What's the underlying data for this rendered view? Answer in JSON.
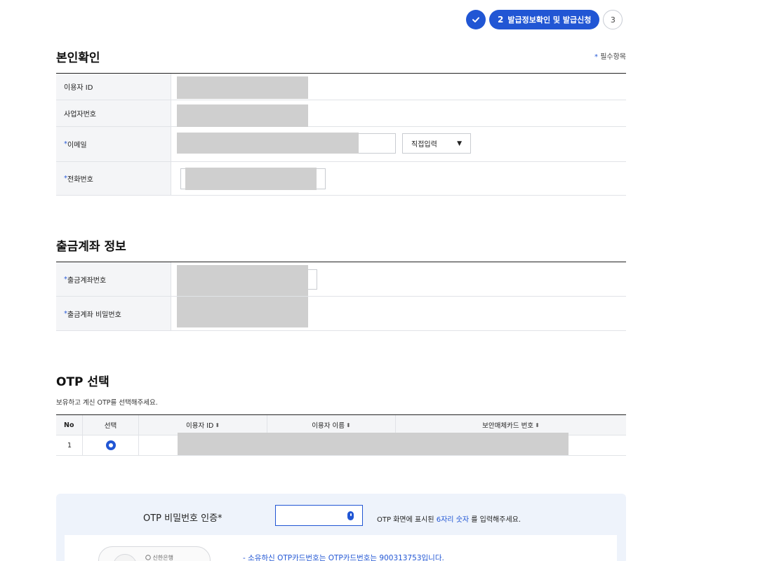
{
  "steps": {
    "active_number": "2",
    "active_label": "발급정보확인 및 발급신청",
    "next_number": "3"
  },
  "identity": {
    "title": "본인확인",
    "required_mark": "*",
    "required_note": "필수항목",
    "rows": [
      {
        "label": "이용자 ID",
        "required": false
      },
      {
        "label": "사업자번호",
        "required": false
      },
      {
        "label": "이메일",
        "required": true
      },
      {
        "label": "전화번호",
        "required": true
      }
    ],
    "email_domain_select": "직접입력"
  },
  "account": {
    "title": "출금계좌 정보",
    "rows": [
      {
        "label": "출금계좌번호",
        "required": true
      },
      {
        "label": "출금계좌 비밀번호",
        "required": true
      }
    ]
  },
  "otp_select": {
    "title": "OTP 선택",
    "help": "보유하고 계신 OTP를 선택해주세요.",
    "columns": [
      "No",
      "선택",
      "이용자 ID",
      "이용자 이름",
      "보안매체카드 번호"
    ],
    "sort_icon": "⬍",
    "rows": [
      {
        "no": "1",
        "selected": true
      }
    ]
  },
  "otp_auth": {
    "label": "OTP 비밀번호 인증*",
    "hint_pre": "OTP 화면에 표시된 ",
    "hint_highlight": "6자리 숫자",
    "hint_post": " 를 입력해주세요.",
    "card_bank": "신한은행",
    "note": "- 소유하신 OTP카드번호는 OTP카드번호는 900313753입니다."
  },
  "colors": {
    "primary": "#2156d4",
    "required": "#2a5bd7",
    "masked": "#cfcfcf",
    "panel_bg": "#eef3fb"
  }
}
